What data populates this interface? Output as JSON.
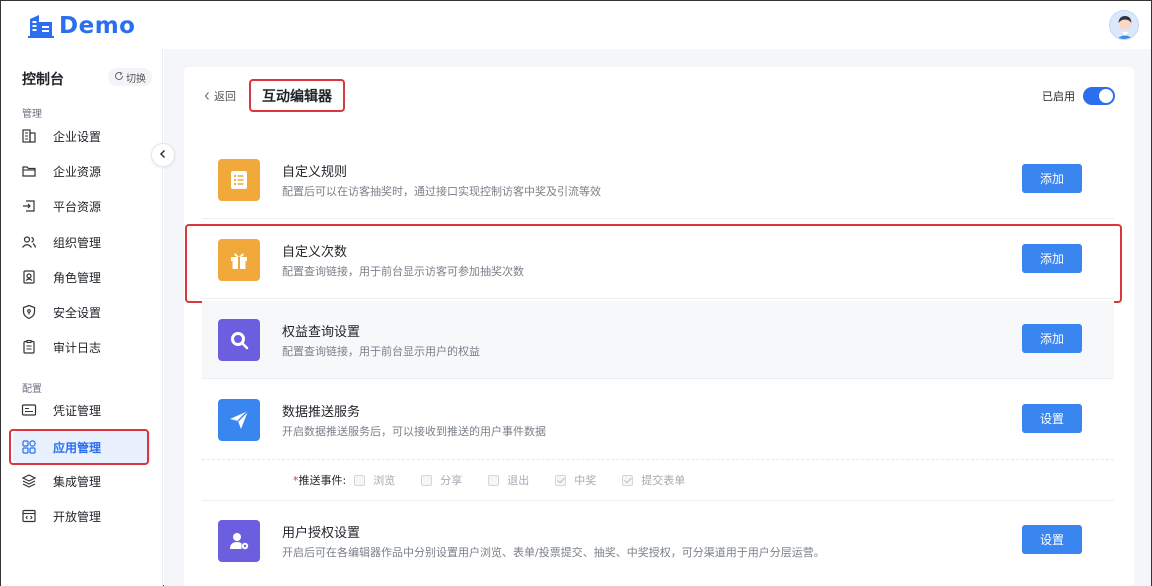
{
  "header": {
    "logo_text": "Demo"
  },
  "sidebar": {
    "title": "控制台",
    "switch_label": "切换",
    "groups": [
      {
        "label": "管理"
      },
      {
        "label": "配置"
      }
    ],
    "items": [
      {
        "label": "企业设置",
        "icon": "building-icon"
      },
      {
        "label": "企业资源",
        "icon": "folder-icon"
      },
      {
        "label": "平台资源",
        "icon": "import-icon"
      },
      {
        "label": "组织管理",
        "icon": "users-icon"
      },
      {
        "label": "角色管理",
        "icon": "role-icon"
      },
      {
        "label": "安全设置",
        "icon": "shield-icon"
      },
      {
        "label": "审计日志",
        "icon": "clipboard-icon"
      },
      {
        "label": "凭证管理",
        "icon": "card-icon"
      },
      {
        "label": "应用管理",
        "icon": "apps-icon",
        "active": true
      },
      {
        "label": "集成管理",
        "icon": "layers-icon"
      },
      {
        "label": "开放管理",
        "icon": "code-icon"
      }
    ]
  },
  "page": {
    "back_label": "返回",
    "title": "互动编辑器",
    "enabled_label": "已启用",
    "enabled": true
  },
  "features": [
    {
      "name": "自定义规则",
      "desc": "配置后可以在访客抽奖时，通过接口实现控制访客中奖及引流等效",
      "button": "添加",
      "icon": "list-icon",
      "color": "#f0a93a"
    },
    {
      "name": "自定义次数",
      "desc": "配置查询链接，用于前台显示访客可参加抽奖次数",
      "button": "添加",
      "icon": "gift-icon",
      "color": "#f0a93a"
    },
    {
      "name": "权益查询设置",
      "desc": "配置查询链接，用于前台显示用户的权益",
      "button": "添加",
      "icon": "search-icon",
      "color": "#6b5fe0"
    },
    {
      "name": "数据推送服务",
      "desc": "开启数据推送服务后，可以接收到推送的用户事件数据",
      "button": "设置",
      "icon": "send-icon",
      "color": "#3a86f0"
    },
    {
      "name": "用户授权设置",
      "desc": "开启后可在各编辑器作品中分别设置用户浏览、表单/投票提交、抽奖、中奖授权，可分渠道用于用户分层运营。",
      "button": "设置",
      "icon": "user-auth-icon",
      "color": "#6b5fe0"
    }
  ],
  "push_events": {
    "label": "推送事件:",
    "options": [
      {
        "label": "浏览",
        "checked": false
      },
      {
        "label": "分享",
        "checked": false
      },
      {
        "label": "退出",
        "checked": false
      },
      {
        "label": "中奖",
        "checked": true
      },
      {
        "label": "提交表单",
        "checked": true
      }
    ]
  }
}
